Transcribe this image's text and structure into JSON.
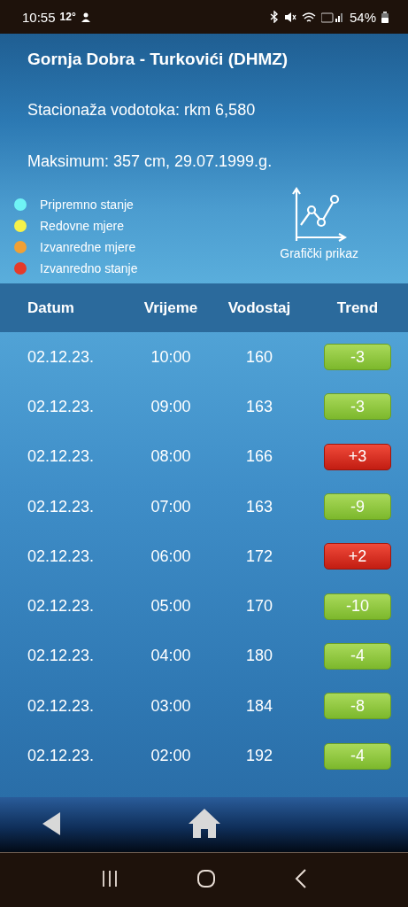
{
  "status_bar": {
    "time": "10:55",
    "temperature": "12°",
    "battery": "54%"
  },
  "station": {
    "title": "Gornja Dobra - Turkovići (DHMZ)",
    "stationing": "Stacionaža vodotoka: rkm 6,580",
    "maximum": "Maksimum: 357 cm, 29.07.1999.g."
  },
  "legend": [
    {
      "label": "Pripremno stanje",
      "color": "#6ff3f5"
    },
    {
      "label": "Redovne mjere",
      "color": "#f5f24a"
    },
    {
      "label": "Izvanredne mjere",
      "color": "#f0a035"
    },
    {
      "label": "Izvanredno stanje",
      "color": "#e53a2a"
    }
  ],
  "chart_button": {
    "label": "Grafički prikaz"
  },
  "table": {
    "columns": [
      "Datum",
      "Vrijeme",
      "Vodostaj",
      "Trend"
    ],
    "rows": [
      {
        "date": "02.12.23.",
        "time": "10:00",
        "level": "160",
        "trend": "-3",
        "kind": "fall"
      },
      {
        "date": "02.12.23.",
        "time": "09:00",
        "level": "163",
        "trend": "-3",
        "kind": "fall"
      },
      {
        "date": "02.12.23.",
        "time": "08:00",
        "level": "166",
        "trend": "+3",
        "kind": "rise"
      },
      {
        "date": "02.12.23.",
        "time": "07:00",
        "level": "163",
        "trend": "-9",
        "kind": "fall"
      },
      {
        "date": "02.12.23.",
        "time": "06:00",
        "level": "172",
        "trend": "+2",
        "kind": "rise"
      },
      {
        "date": "02.12.23.",
        "time": "05:00",
        "level": "170",
        "trend": "-10",
        "kind": "fall"
      },
      {
        "date": "02.12.23.",
        "time": "04:00",
        "level": "180",
        "trend": "-4",
        "kind": "fall"
      },
      {
        "date": "02.12.23.",
        "time": "03:00",
        "level": "184",
        "trend": "-8",
        "kind": "fall"
      },
      {
        "date": "02.12.23.",
        "time": "02:00",
        "level": "192",
        "trend": "-4",
        "kind": "fall"
      }
    ]
  }
}
